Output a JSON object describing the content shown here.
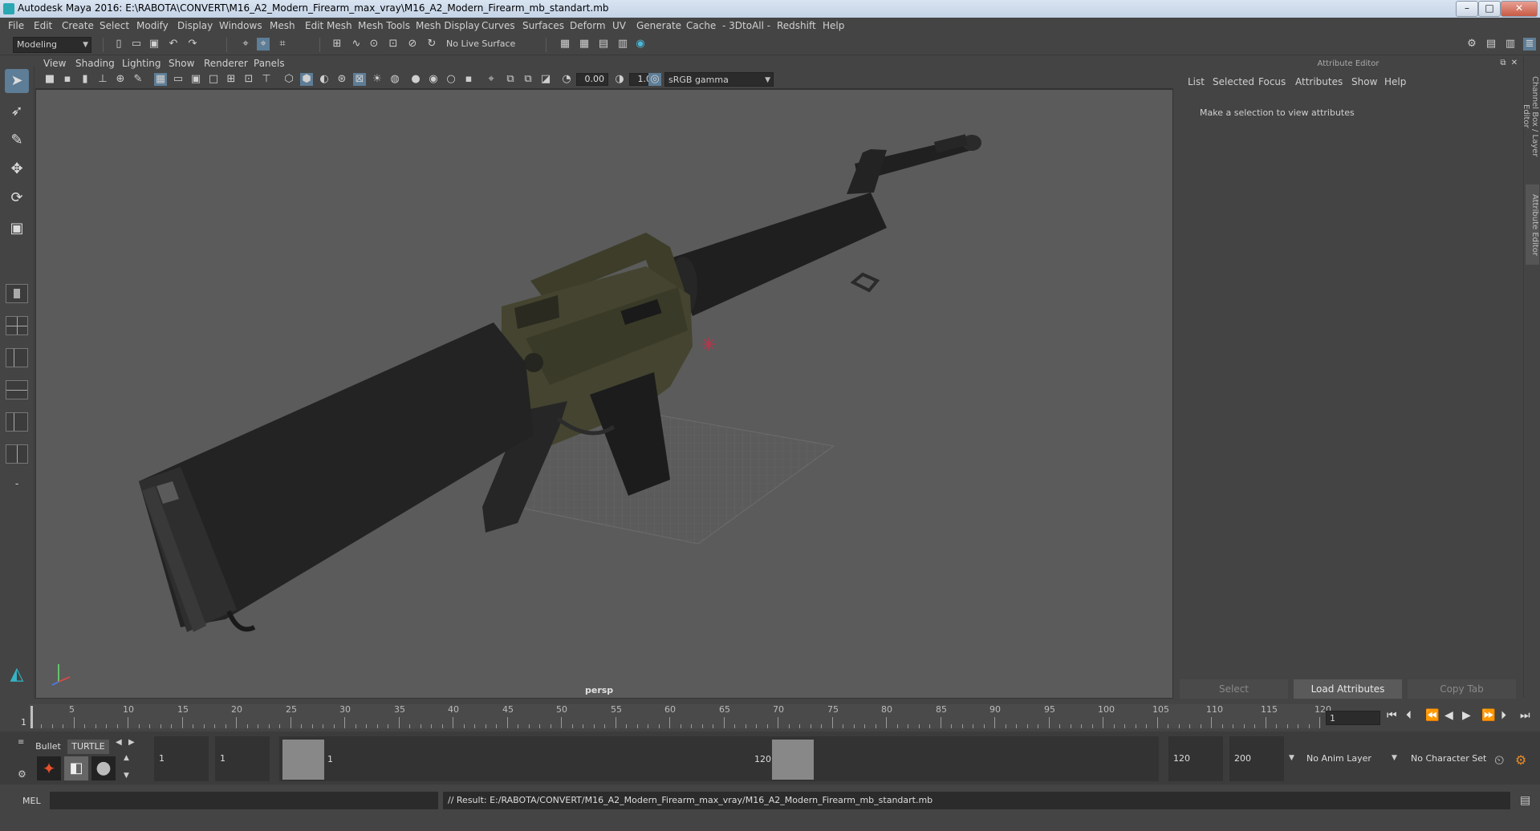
{
  "window": {
    "title": "Autodesk Maya 2016: E:\\RABOTA\\CONVERT\\M16_A2_Modern_Firearm_max_vray\\M16_A2_Modern_Firearm_mb_standart.mb",
    "minimize": "–",
    "maximize": "□",
    "close": "✕"
  },
  "menubar": [
    "File",
    "Edit",
    "Create",
    "Select",
    "Modify",
    "Display",
    "Windows",
    "Mesh",
    "Edit Mesh",
    "Mesh Tools",
    "Mesh Display",
    "Curves",
    "Surfaces",
    "Deform",
    "UV",
    "Generate",
    "Cache",
    "- 3DtoAll -",
    "Redshift",
    "Help"
  ],
  "statusline": {
    "mode": "Modeling",
    "live_surface": "No Live Surface"
  },
  "panel": {
    "menus": [
      "View",
      "Shading",
      "Lighting",
      "Show",
      "Renderer",
      "Panels"
    ],
    "exposure": "0.00",
    "gamma": "1.00",
    "color_space": "sRGB gamma",
    "camera_label": "persp"
  },
  "attribute_editor": {
    "header": "Attribute Editor",
    "menus": [
      "List",
      "Selected",
      "Focus",
      "Attributes",
      "Show",
      "Help"
    ],
    "message": "Make a selection to view attributes",
    "buttons": {
      "select": "Select",
      "load": "Load Attributes",
      "copy": "Copy Tab"
    }
  },
  "side_tabs": {
    "channel_box": "Channel Box / Layer Editor",
    "attr_editor": "Attribute Editor"
  },
  "timeline": {
    "ticks": [
      "5",
      "10",
      "15",
      "20",
      "25",
      "30",
      "35",
      "40",
      "45",
      "50",
      "55",
      "60",
      "65",
      "70",
      "75",
      "80",
      "85",
      "90",
      "95",
      "100",
      "105",
      "110",
      "115",
      "120"
    ],
    "start_mark": "1",
    "current_frame": "1"
  },
  "range": {
    "shelf_tabs": [
      "Bullet",
      "TURTLE"
    ],
    "start_time": "1",
    "playback_start": "1",
    "range_start_label": "1",
    "range_end_label": "120",
    "playback_end": "120",
    "end_time": "200",
    "anim_layer": "No Anim Layer",
    "char_set": "No Character Set"
  },
  "command": {
    "lang": "MEL",
    "result": "// Result: E:/RABOTA/CONVERT/M16_A2_Modern_Firearm_max_vray/M16_A2_Modern_Firearm_mb_standart.mb"
  },
  "colors": {
    "selection_highlight": "#5e7d96",
    "viewport_bg": "#5b5b5b",
    "receiver_olive": "#4a4a30"
  }
}
